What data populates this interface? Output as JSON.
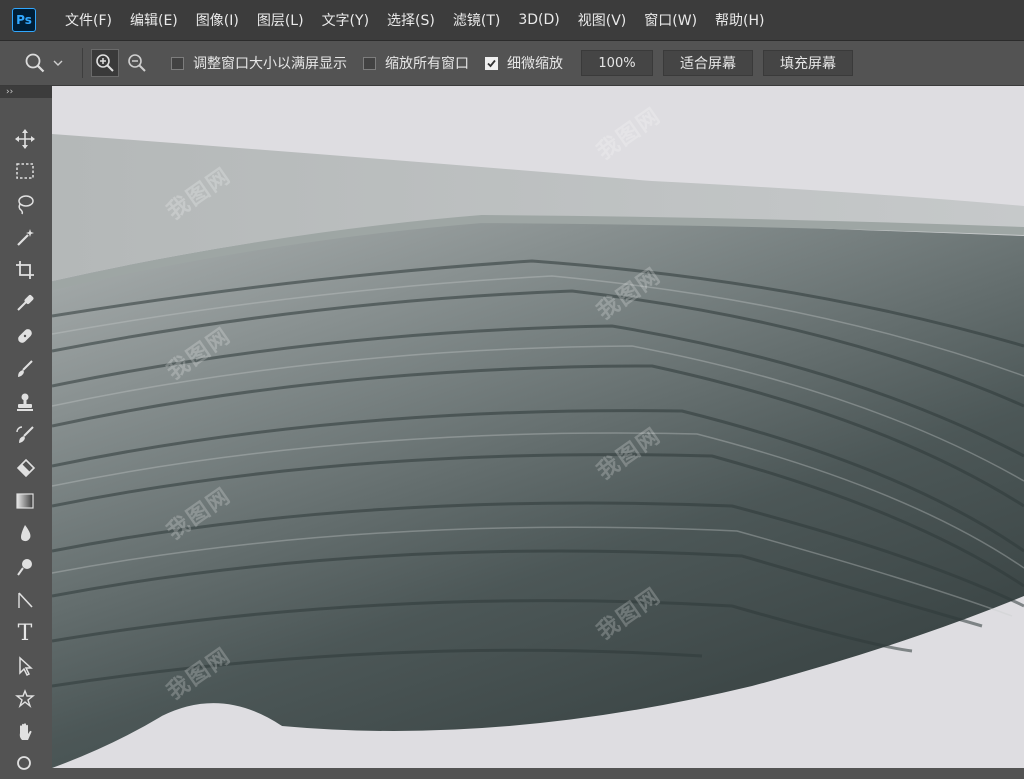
{
  "app": {
    "logo": "Ps"
  },
  "menu": {
    "items": [
      {
        "label": "文件(F)"
      },
      {
        "label": "编辑(E)"
      },
      {
        "label": "图像(I)"
      },
      {
        "label": "图层(L)"
      },
      {
        "label": "文字(Y)"
      },
      {
        "label": "选择(S)"
      },
      {
        "label": "滤镜(T)"
      },
      {
        "label": "3D(D)"
      },
      {
        "label": "视图(V)"
      },
      {
        "label": "窗口(W)"
      },
      {
        "label": "帮助(H)"
      }
    ]
  },
  "options": {
    "resize_windows": {
      "label": "调整窗口大小以满屏显示",
      "checked": false
    },
    "zoom_all_windows": {
      "label": "缩放所有窗口",
      "checked": false
    },
    "scrubby_zoom": {
      "label": "细微缩放",
      "checked": true
    },
    "zoom_value": "100%",
    "fit_screen_label": "适合屏幕",
    "fill_screen_label": "填充屏幕"
  },
  "toolbar": {
    "collapse_glyph": "››",
    "type_tool_glyph": "T",
    "tools": [
      "move-tool",
      "marquee-tool",
      "lasso-tool",
      "magic-wand-tool",
      "crop-tool",
      "eyedropper-tool",
      "healing-brush-tool",
      "brush-tool",
      "clone-stamp-tool",
      "history-brush-tool",
      "eraser-tool",
      "gradient-tool",
      "blur-tool",
      "dodge-tool",
      "pen-tool",
      "type-tool",
      "path-selection-tool",
      "shape-tool",
      "hand-tool",
      "zoom-tool"
    ]
  },
  "canvas": {
    "watermark_text": "我图网",
    "background_color": "#dedde1",
    "leaf_colors": [
      "#3f4a4a",
      "#6b7575",
      "#9aa1a1"
    ]
  },
  "colors": {
    "menubar": "#3c3c3c",
    "panel": "#535353",
    "accent": "#31a8ff"
  }
}
